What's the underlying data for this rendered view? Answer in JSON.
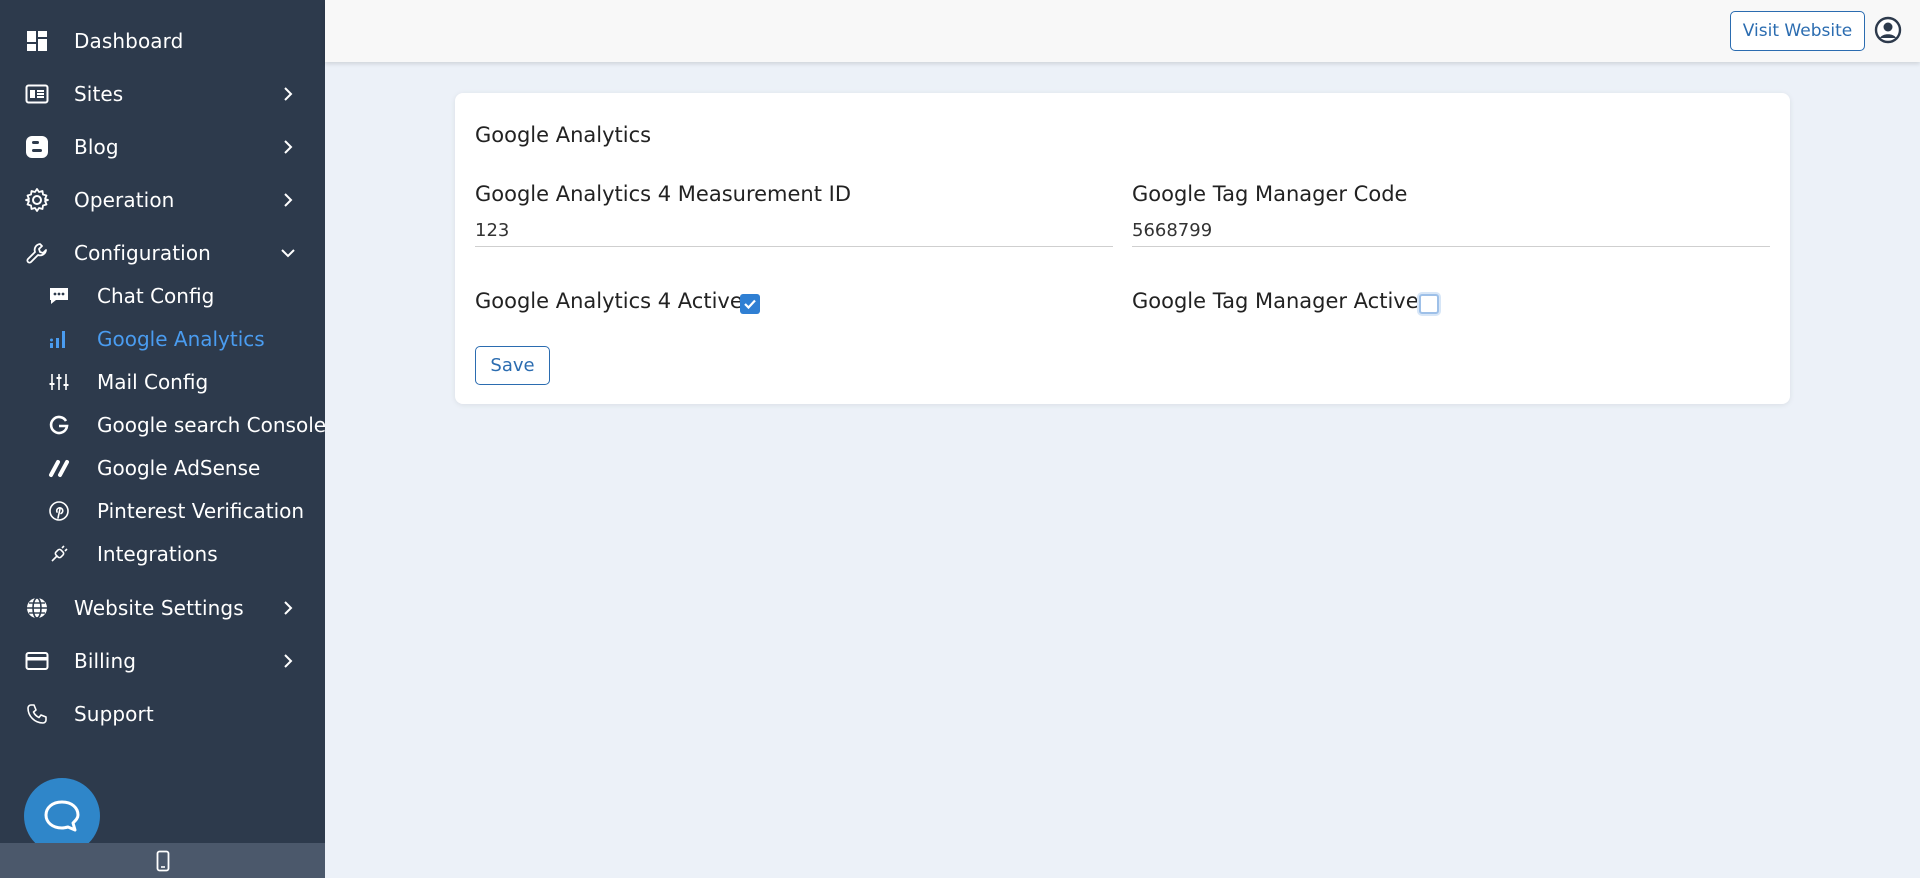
{
  "sidebar": {
    "items": [
      {
        "label": "Dashboard",
        "icon": "dashboard-icon"
      },
      {
        "label": "Sites",
        "icon": "sites-icon"
      },
      {
        "label": "Blog",
        "icon": "blogger-icon"
      },
      {
        "label": "Operation",
        "icon": "gear-icon"
      },
      {
        "label": "Configuration",
        "icon": "wrench-icon"
      },
      {
        "label": "Website Settings",
        "icon": "globe-icon"
      },
      {
        "label": "Billing",
        "icon": "credit-card-icon"
      },
      {
        "label": "Support",
        "icon": "phone-icon"
      }
    ],
    "sub_items": [
      {
        "label": "Chat Config",
        "icon": "chat-icon"
      },
      {
        "label": "Google Analytics",
        "icon": "bar-chart-icon"
      },
      {
        "label": "Mail Config",
        "icon": "sliders-icon"
      },
      {
        "label": "Google search Console",
        "icon": "google-icon"
      },
      {
        "label": "Google AdSense",
        "icon": "adsense-icon"
      },
      {
        "label": "Pinterest Verification",
        "icon": "pinterest-icon"
      },
      {
        "label": "Integrations",
        "icon": "plug-icon"
      }
    ],
    "active_sub_item": "Google Analytics"
  },
  "header": {
    "visit_label": "Visit Website"
  },
  "card": {
    "title": "Google Analytics",
    "ga4_label": "Google Analytics 4 Measurement ID",
    "ga4_value": "123",
    "gtm_label": "Google Tag Manager Code",
    "gtm_value": "5668799",
    "ga4_active_label": "Google Analytics 4 Active",
    "ga4_active": true,
    "gtm_active_label": "Google Tag Manager Active",
    "gtm_active": false,
    "save_label": "Save"
  },
  "colors": {
    "sidebar_bg": "#2d3a4c",
    "active_link": "#4a9cf0",
    "accent": "#2b6cb0",
    "page_bg": "#ecf1f8",
    "checkbox_on": "#2f7fd3"
  }
}
